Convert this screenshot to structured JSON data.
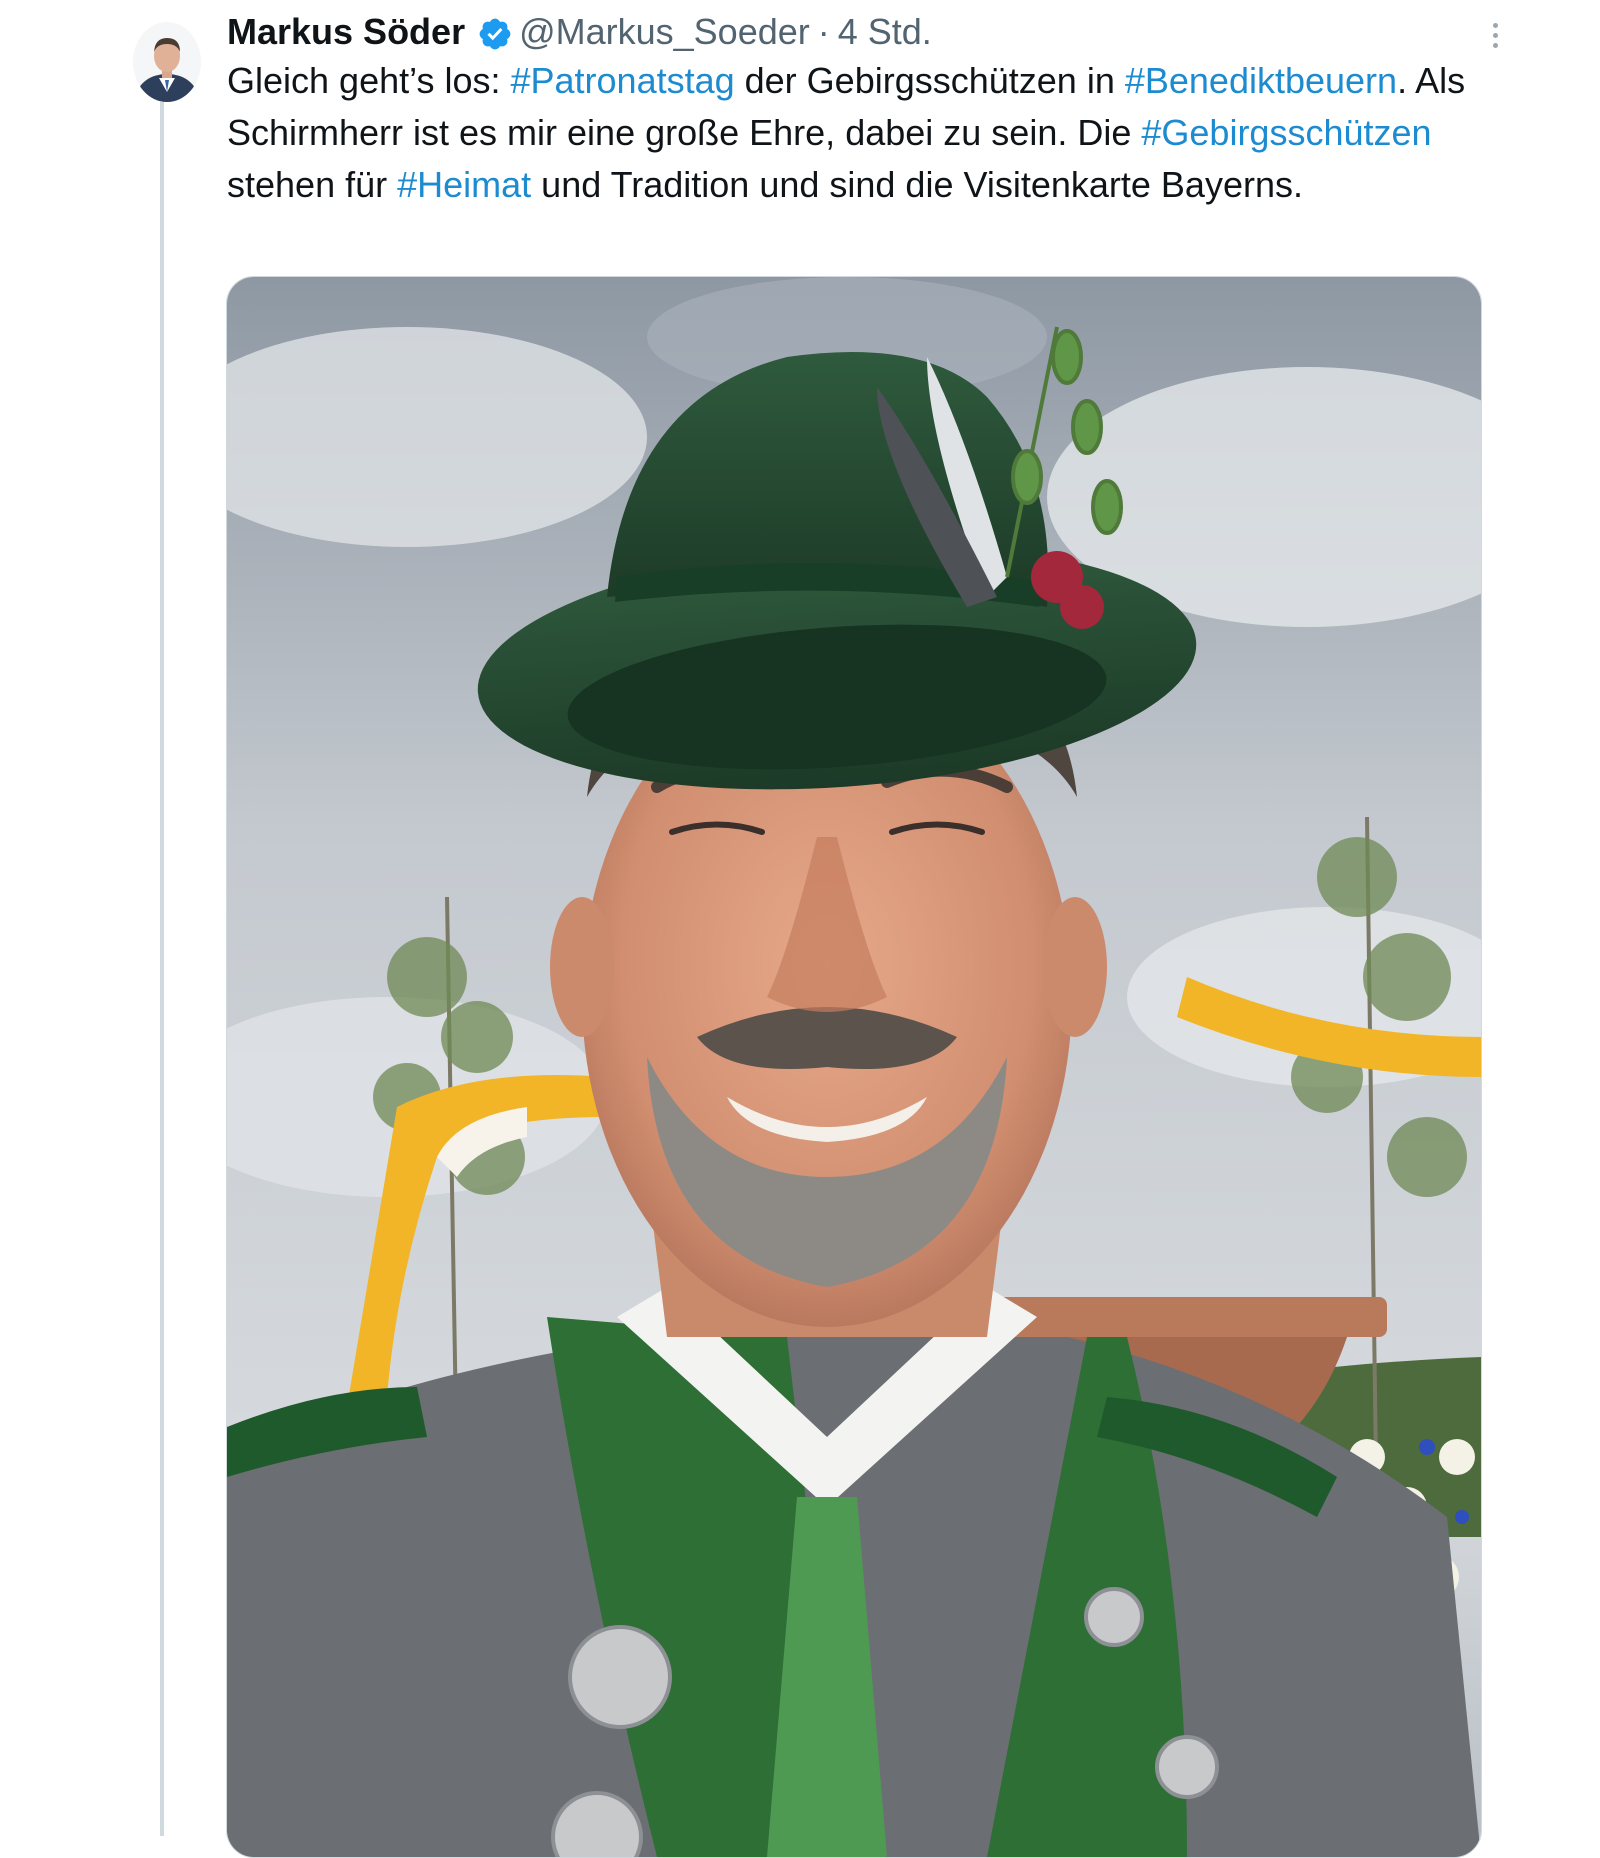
{
  "author": {
    "display_name": "Markus Söder",
    "handle": "@Markus_Soeder",
    "separator": "·",
    "timestamp": "4 Std.",
    "verified": true,
    "verified_color": "#1d9bf0"
  },
  "tweet": {
    "segments": [
      {
        "text": "Gleich geht’s los: ",
        "hashtag": false
      },
      {
        "text": "#Patronatstag",
        "hashtag": true
      },
      {
        "text": " der Gebirgsschützen in ",
        "hashtag": false
      },
      {
        "text": "#Benediktbeuern",
        "hashtag": true
      },
      {
        "text": ". Als Schirmherr ist es mir eine große Ehre, dabei zu sein. Die ",
        "hashtag": false
      },
      {
        "text": "#Gebirgsschützen",
        "hashtag": true
      },
      {
        "text": " stehen für ",
        "hashtag": false
      },
      {
        "text": "#Heimat",
        "hashtag": true
      },
      {
        "text": " und Tradition und sind die Visitenkarte Bayerns.",
        "hashtag": false
      }
    ],
    "hashtag_color": "#1d8bd0"
  },
  "icons": {
    "verified": "verified-badge-icon",
    "more": "more-options-icon"
  },
  "media": {
    "type": "photo",
    "subject": "selfie of a smiling man wearing a green felt hat with feathers and flowers, grey and green traditional jacket with silver coin buttons, yellow-white drapes and cloudy sky in background"
  }
}
